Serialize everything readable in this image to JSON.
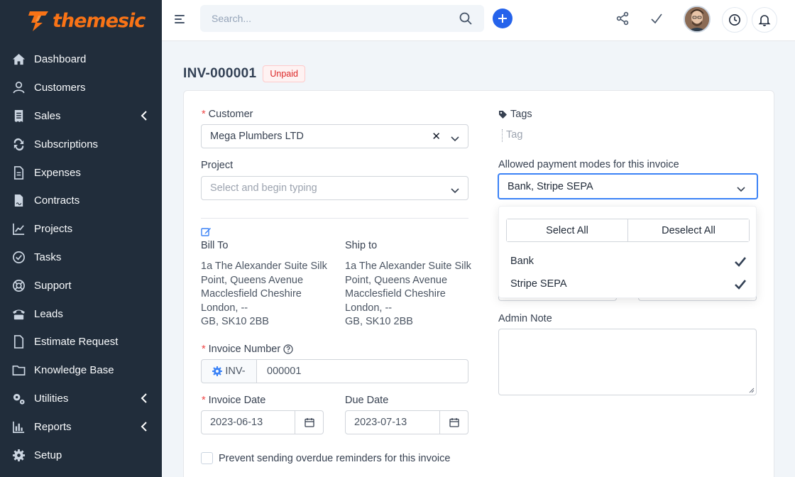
{
  "brand": {
    "name": "themesic"
  },
  "sidebar": {
    "items": [
      {
        "label": "Dashboard",
        "icon": "home-icon",
        "has_submenu": false
      },
      {
        "label": "Customers",
        "icon": "user-icon",
        "has_submenu": false
      },
      {
        "label": "Sales",
        "icon": "receipt-icon",
        "has_submenu": true
      },
      {
        "label": "Subscriptions",
        "icon": "repeat-icon",
        "has_submenu": false
      },
      {
        "label": "Expenses",
        "icon": "file-text-icon",
        "has_submenu": false
      },
      {
        "label": "Contracts",
        "icon": "file-contract-icon",
        "has_submenu": false
      },
      {
        "label": "Projects",
        "icon": "chart-icon",
        "has_submenu": false
      },
      {
        "label": "Tasks",
        "icon": "check-circle-icon",
        "has_submenu": false
      },
      {
        "label": "Support",
        "icon": "lifebuoy-icon",
        "has_submenu": false
      },
      {
        "label": "Leads",
        "icon": "tty-icon",
        "has_submenu": false
      },
      {
        "label": "Estimate Request",
        "icon": "file-icon",
        "has_submenu": false
      },
      {
        "label": "Knowledge Base",
        "icon": "folder-icon",
        "has_submenu": false
      },
      {
        "label": "Utilities",
        "icon": "cogs-icon",
        "has_submenu": true
      },
      {
        "label": "Reports",
        "icon": "bar-chart-icon",
        "has_submenu": true
      },
      {
        "label": "Setup",
        "icon": "gear-icon",
        "has_submenu": false
      }
    ]
  },
  "topbar": {
    "search_placeholder": "Search..."
  },
  "invoice": {
    "number_title": "INV-000001",
    "status": "Unpaid",
    "customer_label": "Customer",
    "customer_value": "Mega Plumbers LTD",
    "project_label": "Project",
    "project_placeholder": "Select and begin typing",
    "bill_to_label": "Bill To",
    "ship_to_label": "Ship to",
    "bill_to_address": "1a The Alexander Suite Silk\nPoint, Queens Avenue\nMacclesfield Cheshire\nLondon, --\nGB, SK10 2BB",
    "ship_to_address": "1a The Alexander Suite Silk\nPoint, Queens Avenue\nMacclesfield Cheshire\nLondon, --\nGB, SK10 2BB",
    "invoice_number_label": "Invoice Number",
    "invoice_prefix": "INV-",
    "invoice_number": "000001",
    "invoice_date_label": "Invoice Date",
    "invoice_date": "2023-06-13",
    "due_date_label": "Due Date",
    "due_date": "2023-07-13",
    "overdue_reminder_label": "Prevent sending overdue reminders for this invoice",
    "tags_label": "Tags",
    "tag_placeholder": "Tag",
    "payment_modes_label": "Allowed payment modes for this invoice",
    "payment_modes_value": "Bank, Stripe SEPA",
    "admin_note_label": "Admin Note"
  },
  "payment_dropdown": {
    "select_all": "Select All",
    "deselect_all": "Deselect All",
    "options": [
      {
        "label": "Bank",
        "selected": true
      },
      {
        "label": "Stripe SEPA",
        "selected": true
      }
    ]
  },
  "colors": {
    "sidebar_bg": "#212d3b",
    "accent": "#2563eb",
    "brand": "#f97316",
    "status_unpaid": "#dc2626"
  }
}
